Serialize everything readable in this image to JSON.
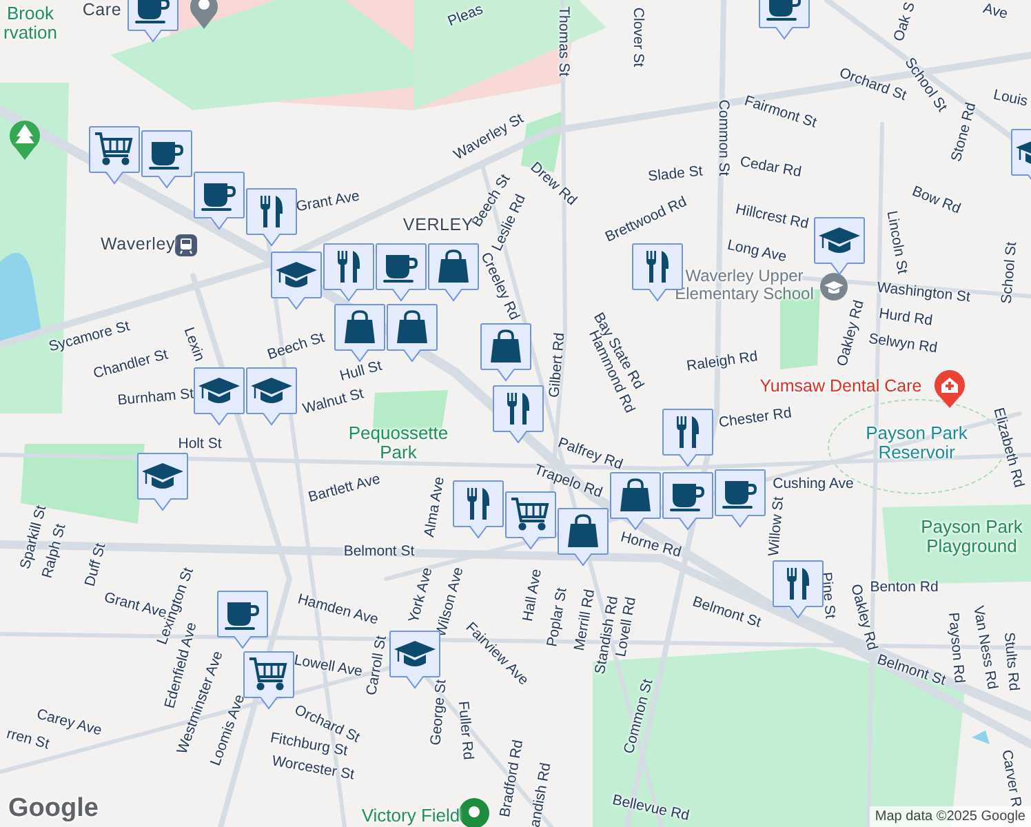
{
  "map": {
    "labels": [
      {
        "text": "Brook",
        "kind": "park"
      },
      {
        "text": "rvation",
        "kind": "park"
      },
      {
        "text": "Care",
        "kind": "place"
      },
      {
        "text": "Pleas",
        "kind": "street"
      },
      {
        "text": "Thomas St",
        "kind": "street"
      },
      {
        "text": "Clover St",
        "kind": "street"
      },
      {
        "text": "Oak S",
        "kind": "street"
      },
      {
        "text": "Ave",
        "kind": "street"
      },
      {
        "text": "School St",
        "kind": "street"
      },
      {
        "text": "Orchard St",
        "kind": "street"
      },
      {
        "text": "Louis",
        "kind": "street"
      },
      {
        "text": "Fairmont St",
        "kind": "street"
      },
      {
        "text": "Waverley St",
        "kind": "street"
      },
      {
        "text": "Stone Rd",
        "kind": "street"
      },
      {
        "text": "Drew Rd",
        "kind": "street"
      },
      {
        "text": "Slade St",
        "kind": "street"
      },
      {
        "text": "Cedar Rd",
        "kind": "street"
      },
      {
        "text": "Common St",
        "kind": "street"
      },
      {
        "text": "Beech St",
        "kind": "street"
      },
      {
        "text": "Grant Ave",
        "kind": "street"
      },
      {
        "text": "Hillcrest Rd",
        "kind": "street"
      },
      {
        "text": "Bow Rd",
        "kind": "street"
      },
      {
        "text": "Brettwood Rd",
        "kind": "street"
      },
      {
        "text": "Leslie Rd",
        "kind": "street"
      },
      {
        "text": "VERLEY",
        "kind": "place"
      },
      {
        "text": "Waverley",
        "kind": "place"
      },
      {
        "text": "Lincoln St",
        "kind": "street"
      },
      {
        "text": "Long Ave",
        "kind": "street"
      },
      {
        "text": "Creeley Rd",
        "kind": "street"
      },
      {
        "text": "Washington St",
        "kind": "street"
      },
      {
        "text": "School St",
        "kind": "street"
      },
      {
        "text": "Waverley Upper Elementary School",
        "kind": "poi"
      },
      {
        "text": "Bay State Rd",
        "kind": "street"
      },
      {
        "text": "Hurd Rd",
        "kind": "street"
      },
      {
        "text": "Selwyn Rd",
        "kind": "street"
      },
      {
        "text": "Oakley Rd",
        "kind": "street"
      },
      {
        "text": "Sycamore St",
        "kind": "street"
      },
      {
        "text": "Chandler St",
        "kind": "street"
      },
      {
        "text": "Lexin",
        "kind": "street"
      },
      {
        "text": "Beech St",
        "kind": "street"
      },
      {
        "text": "Hull St",
        "kind": "street"
      },
      {
        "text": "Hammond Rd",
        "kind": "street"
      },
      {
        "text": "Gilbert Rd",
        "kind": "street"
      },
      {
        "text": "Raleigh Rd",
        "kind": "street"
      },
      {
        "text": "Burnham St",
        "kind": "street"
      },
      {
        "text": "Walnut St",
        "kind": "street"
      },
      {
        "text": "Yumsaw Dental Care",
        "kind": "health"
      },
      {
        "text": "Chester Rd",
        "kind": "street"
      },
      {
        "text": "Holt St",
        "kind": "street"
      },
      {
        "text": "Pequossette Park",
        "kind": "park"
      },
      {
        "text": "Payson Park Reservoir",
        "kind": "water"
      },
      {
        "text": "Elizabeth Rd",
        "kind": "street"
      },
      {
        "text": "Palfrey Rd",
        "kind": "street"
      },
      {
        "text": "Cushing Ave",
        "kind": "street"
      },
      {
        "text": "Bartlett Ave",
        "kind": "street"
      },
      {
        "text": "Alma Ave",
        "kind": "street"
      },
      {
        "text": "Trapelo Rd",
        "kind": "street"
      },
      {
        "text": "Belmont St",
        "kind": "street"
      },
      {
        "text": "Horne Rd",
        "kind": "street"
      },
      {
        "text": "Willow St",
        "kind": "street"
      },
      {
        "text": "Payson Park Playground",
        "kind": "park"
      },
      {
        "text": "Benton Rd",
        "kind": "street"
      },
      {
        "text": "Pine St",
        "kind": "street"
      },
      {
        "text": "Oakley Rd",
        "kind": "street"
      },
      {
        "text": "Payson Rd",
        "kind": "street"
      },
      {
        "text": "Van Ness Rd",
        "kind": "street"
      },
      {
        "text": "Stults Rd",
        "kind": "street"
      },
      {
        "text": "Belmont St",
        "kind": "street"
      },
      {
        "text": "Belmont St",
        "kind": "street"
      },
      {
        "text": "Grant Ave",
        "kind": "street"
      },
      {
        "text": "Sparkill St",
        "kind": "street"
      },
      {
        "text": "Ralph St",
        "kind": "street"
      },
      {
        "text": "Duff St",
        "kind": "street"
      },
      {
        "text": "Lexington St",
        "kind": "street"
      },
      {
        "text": "Hamden Ave",
        "kind": "street"
      },
      {
        "text": "York Ave",
        "kind": "street"
      },
      {
        "text": "Wilson Ave",
        "kind": "street"
      },
      {
        "text": "Hall Ave",
        "kind": "street"
      },
      {
        "text": "Poplar St",
        "kind": "street"
      },
      {
        "text": "Merrill Rd",
        "kind": "street"
      },
      {
        "text": "Standish Rd",
        "kind": "street"
      },
      {
        "text": "Lovell Rd",
        "kind": "street"
      },
      {
        "text": "Fairview Ave",
        "kind": "street"
      },
      {
        "text": "Edenfield Ave",
        "kind": "street"
      },
      {
        "text": "Westminster Ave",
        "kind": "street"
      },
      {
        "text": "Loomis Ave",
        "kind": "street"
      },
      {
        "text": "Lowell Ave",
        "kind": "street"
      },
      {
        "text": "Carroll St",
        "kind": "street"
      },
      {
        "text": "Orchard St",
        "kind": "street"
      },
      {
        "text": "Common St",
        "kind": "street"
      },
      {
        "text": "George St",
        "kind": "street"
      },
      {
        "text": "Fuller Rd",
        "kind": "street"
      },
      {
        "text": "Fitchburg St",
        "kind": "street"
      },
      {
        "text": "Worcester St",
        "kind": "street"
      },
      {
        "text": "Carey Ave",
        "kind": "street"
      },
      {
        "text": "rren St",
        "kind": "street"
      },
      {
        "text": "Bradford Rd",
        "kind": "street"
      },
      {
        "text": "andish Rd",
        "kind": "street"
      },
      {
        "text": "Bellevue Rd",
        "kind": "street"
      },
      {
        "text": "Carver R",
        "kind": "street"
      },
      {
        "text": "Victory Field",
        "kind": "park"
      }
    ],
    "markers": [
      {
        "kind": "cafe"
      },
      {
        "kind": "cafe"
      },
      {
        "kind": "cart"
      },
      {
        "kind": "cafe"
      },
      {
        "kind": "cafe"
      },
      {
        "kind": "food"
      },
      {
        "kind": "school"
      },
      {
        "kind": "food"
      },
      {
        "kind": "cafe"
      },
      {
        "kind": "shop"
      },
      {
        "kind": "shop"
      },
      {
        "kind": "shop"
      },
      {
        "kind": "shop"
      },
      {
        "kind": "food"
      },
      {
        "kind": "food"
      },
      {
        "kind": "school"
      },
      {
        "kind": "school"
      },
      {
        "kind": "school"
      },
      {
        "kind": "school"
      },
      {
        "kind": "school"
      },
      {
        "kind": "food"
      },
      {
        "kind": "cafe"
      },
      {
        "kind": "shop"
      },
      {
        "kind": "cafe"
      },
      {
        "kind": "food"
      },
      {
        "kind": "cart"
      },
      {
        "kind": "shop"
      },
      {
        "kind": "cafe"
      },
      {
        "kind": "cart"
      },
      {
        "kind": "school"
      },
      {
        "kind": "food"
      }
    ]
  },
  "logo": "Google",
  "attribution": "Map data ©2025 Google"
}
